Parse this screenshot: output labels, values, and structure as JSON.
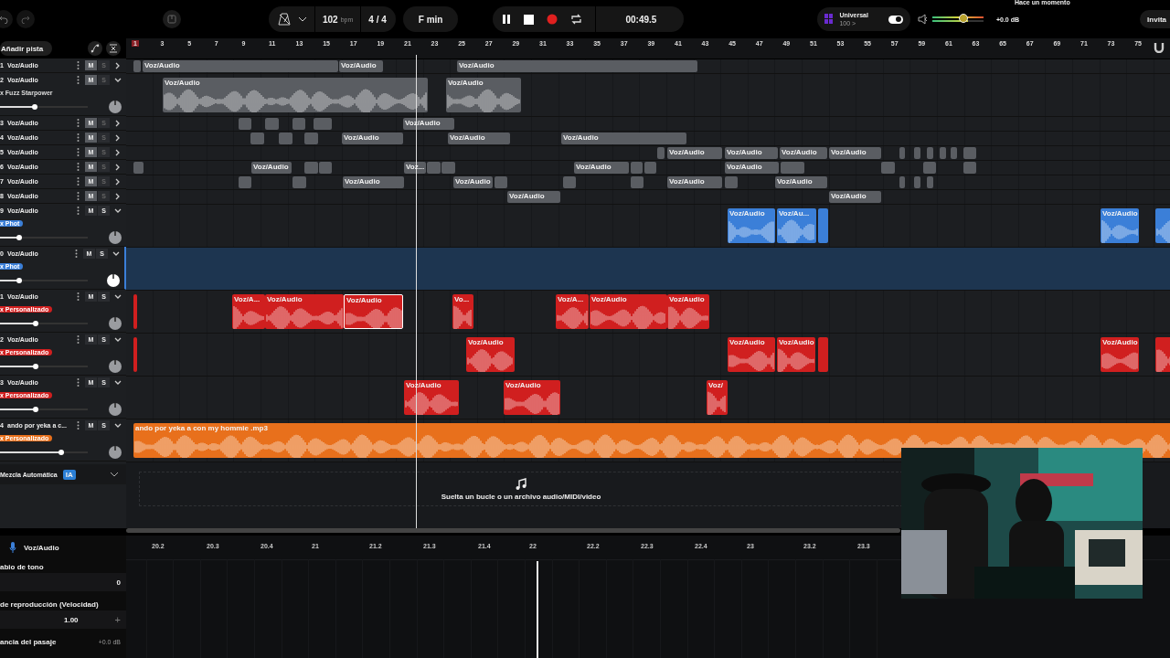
{
  "topbar": {
    "tempo": "102",
    "tempo_unit": "bpm",
    "time_signature": "4 / 4",
    "key": "F min",
    "time": "00:49.5",
    "preset": {
      "name": "Universal",
      "value": "100 >",
      "on": true
    },
    "master": {
      "level": 0.6,
      "reading": "+0.0 dB"
    },
    "saved": "Hace un momento",
    "invite": "Invita"
  },
  "track_list": {
    "add_button": "Añadir pista"
  },
  "ruler": [
    "1",
    "3",
    "5",
    "7",
    "9",
    "11",
    "13",
    "15",
    "17",
    "19",
    "21",
    "23",
    "25",
    "27",
    "29",
    "31",
    "33",
    "35",
    "37",
    "39",
    "41",
    "43",
    "45",
    "47",
    "49",
    "51",
    "53",
    "55",
    "57",
    "59",
    "61",
    "63",
    "65",
    "67",
    "69",
    "71",
    "73",
    "75"
  ],
  "tracks": [
    {
      "number": "1",
      "name": "Voz/Audio",
      "color": "#5a5d62",
      "expanded": false,
      "selected": false,
      "mute": {
        "label": "M",
        "on": true
      },
      "solo": {
        "label": "S",
        "on": false
      },
      "clips": [
        {
          "label": "Voz/Audio",
          "selected": false
        },
        {
          "label": "Voz/Audio",
          "selected": false
        },
        {
          "label": "Voz/Audio",
          "selected": false
        }
      ]
    },
    {
      "number": "2",
      "name": "Voz/Audio",
      "color": "#5a5d62",
      "expanded": true,
      "selected": false,
      "mute": {
        "label": "M",
        "on": true
      },
      "solo": {
        "label": "S",
        "on": false
      },
      "fx": {
        "label": "x Fuzz Starpower",
        "pill": false
      },
      "level": 0.4,
      "clips": [
        {
          "label": "Voz/Audio",
          "selected": false
        },
        {
          "label": "Voz/Audio",
          "selected": false
        }
      ]
    },
    {
      "number": "3",
      "name": "Voz/Audio",
      "color": "#5a5d62",
      "expanded": false,
      "selected": false,
      "mute": {
        "label": "M",
        "on": true
      },
      "solo": {
        "label": "S",
        "on": false
      },
      "clips": [
        {
          "label": "Voz/Audio",
          "selected": false
        }
      ]
    },
    {
      "number": "4",
      "name": "Voz/Audio",
      "color": "#5a5d62",
      "expanded": false,
      "selected": false,
      "mute": {
        "label": "M",
        "on": true
      },
      "solo": {
        "label": "S",
        "on": false
      },
      "clips": [
        {
          "label": "Voz/Audio",
          "selected": false
        },
        {
          "label": "Voz/Audio",
          "selected": false
        },
        {
          "label": "Voz/Audio",
          "selected": false
        }
      ]
    },
    {
      "number": "5",
      "name": "Voz/Audio",
      "color": "#5a5d62",
      "expanded": false,
      "selected": false,
      "mute": {
        "label": "M",
        "on": true
      },
      "solo": {
        "label": "S",
        "on": false
      },
      "clips": [
        {
          "label": "Voz/Audio",
          "selected": false
        },
        {
          "label": "Voz/Audio",
          "selected": false
        },
        {
          "label": "Voz/Audio",
          "selected": false
        },
        {
          "label": "Voz/Audio",
          "selected": false
        }
      ]
    },
    {
      "number": "6",
      "name": "Voz/Audio",
      "color": "#5a5d62",
      "expanded": false,
      "selected": false,
      "mute": {
        "label": "M",
        "on": true
      },
      "solo": {
        "label": "S",
        "on": false
      },
      "clips": [
        {
          "label": "Voz/Audio",
          "selected": false
        },
        {
          "label": "Voz...",
          "selected": false
        },
        {
          "label": "Voz/Audio",
          "selected": false
        },
        {
          "label": "Voz/Audio",
          "selected": false
        }
      ]
    },
    {
      "number": "7",
      "name": "Voz/Audio",
      "color": "#5a5d62",
      "expanded": false,
      "selected": false,
      "mute": {
        "label": "M",
        "on": true
      },
      "solo": {
        "label": "S",
        "on": false
      },
      "clips": [
        {
          "label": "Voz/Audio",
          "selected": false
        },
        {
          "label": "Voz/Audio",
          "selected": false
        },
        {
          "label": "Voz/Audio",
          "selected": false
        },
        {
          "label": "Voz/Audio",
          "selected": false
        }
      ]
    },
    {
      "number": "8",
      "name": "Voz/Audio",
      "color": "#5a5d62",
      "expanded": false,
      "selected": false,
      "mute": {
        "label": "M",
        "on": true
      },
      "solo": {
        "label": "S",
        "on": false
      },
      "clips": [
        {
          "label": "Voz/Audio",
          "selected": false
        },
        {
          "label": "Voz/Audio",
          "selected": false
        }
      ]
    },
    {
      "number": "9",
      "name": "Voz/Audio",
      "color": "#3b7fd8",
      "expanded": true,
      "selected": false,
      "mute": {
        "label": "M",
        "on": false
      },
      "solo": {
        "label": "S",
        "on": false
      },
      "fx": {
        "label": "x Phot",
        "pill": true
      },
      "level": 0.22,
      "clips": [
        {
          "label": "Voz/Audio",
          "selected": false
        },
        {
          "label": "Voz/Au...",
          "selected": false
        },
        {
          "label": "Voz/Audio",
          "selected": false
        }
      ]
    },
    {
      "number": "0",
      "name": "Voz/Audio",
      "color": "#3b7fd8",
      "expanded": true,
      "selected": true,
      "mute": {
        "label": "M",
        "on": false
      },
      "solo": {
        "label": "S",
        "on": false
      },
      "fx": {
        "label": "x Phot",
        "pill": true
      },
      "level": 0.22
    },
    {
      "number": "1",
      "name": "Voz/Audio",
      "color": "#d01f1f",
      "expanded": true,
      "selected": false,
      "mute": {
        "label": "M",
        "on": false
      },
      "solo": {
        "label": "S",
        "on": false
      },
      "fx": {
        "label": "x Personalizado",
        "pill": true
      },
      "level": 0.41,
      "clips": [
        {
          "label": "Voz/A...",
          "selected": false
        },
        {
          "label": "Voz/Audio",
          "selected": false
        },
        {
          "label": "Voz/Audio",
          "selected": true
        },
        {
          "label": "Vo...",
          "selected": false
        },
        {
          "label": "Voz/A...",
          "selected": false
        },
        {
          "label": "Voz/Audio",
          "selected": false
        },
        {
          "label": "Voz/Audio",
          "selected": false
        }
      ]
    },
    {
      "number": "2",
      "name": "Voz/Audio",
      "color": "#d01f1f",
      "expanded": true,
      "selected": false,
      "mute": {
        "label": "M",
        "on": false
      },
      "solo": {
        "label": "S",
        "on": false
      },
      "fx": {
        "label": "x Personalizado",
        "pill": true
      },
      "level": 0.41,
      "clips": [
        {
          "label": "Voz/Audio",
          "selected": false
        },
        {
          "label": "Voz/Audio",
          "selected": false
        },
        {
          "label": "Voz/Audio",
          "selected": false
        },
        {
          "label": "Voz/Audio",
          "selected": false
        }
      ]
    },
    {
      "number": "3",
      "name": "Voz/Audio",
      "color": "#d01f1f",
      "expanded": true,
      "selected": false,
      "mute": {
        "label": "M",
        "on": false
      },
      "solo": {
        "label": "S",
        "on": false
      },
      "fx": {
        "label": "x Personalizado",
        "pill": true
      },
      "level": 0.41,
      "clips": [
        {
          "label": "Voz/Audio",
          "selected": false
        },
        {
          "label": "Voz/Audio",
          "selected": false
        },
        {
          "label": "Voz/",
          "selected": false
        }
      ]
    },
    {
      "number": "4",
      "name": "ando por yeka a c...",
      "color": "#e8701c",
      "expanded": true,
      "selected": false,
      "mute": {
        "label": "M",
        "on": false
      },
      "solo": {
        "label": "S",
        "on": false
      },
      "fx": {
        "label": "x Personalizado",
        "pill": true
      },
      "level": 0.7,
      "clips": [
        {
          "label": "ando por yeka a con my hommie .mp3",
          "selected": false
        }
      ]
    }
  ],
  "auto_mix": {
    "label": "Mezcla Automática",
    "badge": "IA"
  },
  "drop_zone": "Suelta un bucle o un archivo audio/MIDI/video",
  "inspector": {
    "track": "Voz/Audio",
    "fields": [
      {
        "kind": "number",
        "label": "abio de tono",
        "value": "0"
      },
      {
        "kind": "stepper",
        "label": "de reproducción (Velocidad)",
        "value": "1.00",
        "button": "+"
      },
      {
        "kind": "inline",
        "label": "ancia del pasaje",
        "value": "+0.0 dB"
      }
    ]
  },
  "detail_ruler": [
    "20.2",
    "20.3",
    "20.4",
    "21",
    "21.2",
    "21.3",
    "21.4",
    "22",
    "22.2",
    "22.3",
    "22.4",
    "23",
    "23.2",
    "23.3"
  ]
}
